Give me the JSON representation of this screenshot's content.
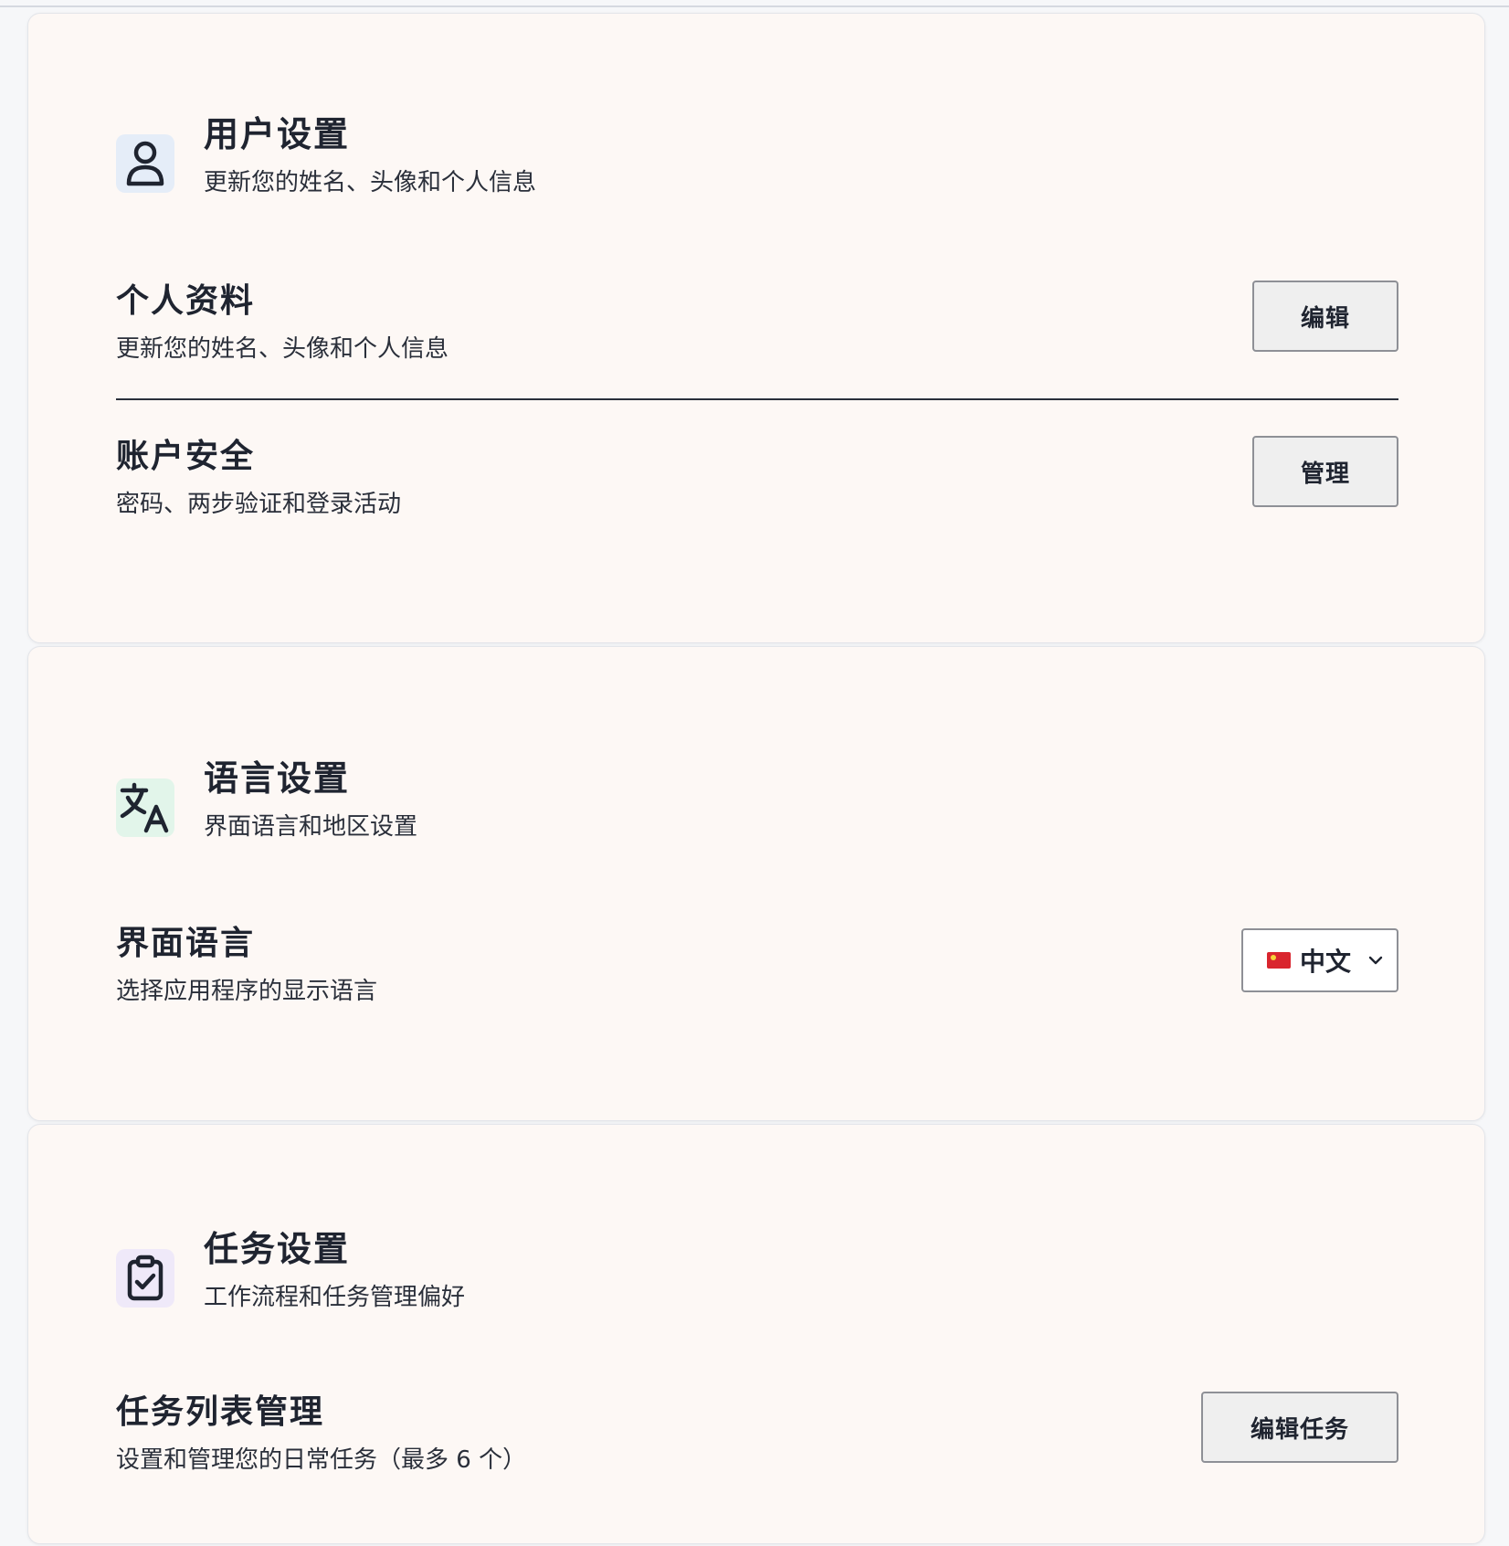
{
  "user_settings": {
    "title": "用户设置",
    "subtitle": "更新您的姓名、头像和个人信息",
    "icon": "user-icon",
    "profile": {
      "title": "个人资料",
      "desc": "更新您的姓名、头像和个人信息",
      "button": "编辑"
    },
    "security": {
      "title": "账户安全",
      "desc": "密码、两步验证和登录活动",
      "button": "管理"
    }
  },
  "language_settings": {
    "title": "语言设置",
    "subtitle": "界面语言和地区设置",
    "icon": "translate-icon",
    "interface_language": {
      "title": "界面语言",
      "desc": "选择应用程序的显示语言",
      "selected": "中文",
      "flag": "china-flag-icon"
    }
  },
  "task_settings": {
    "title": "任务设置",
    "subtitle": "工作流程和任务管理偏好",
    "icon": "clipboard-check-icon",
    "task_list": {
      "title": "任务列表管理",
      "desc": "设置和管理您的日常任务（最多 6 个）",
      "button": "编辑任务"
    }
  },
  "colors": {
    "card_bg": "#fdf8f5",
    "text": "#1f2430",
    "button_bg": "#efefef"
  }
}
